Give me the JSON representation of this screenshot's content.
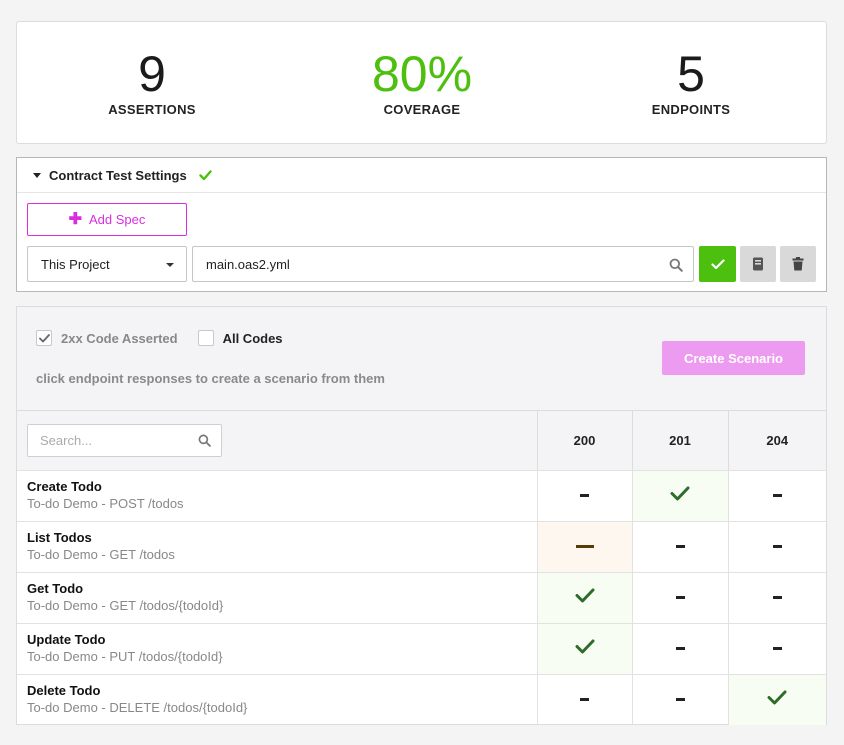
{
  "stats": [
    {
      "value": "9",
      "label": "ASSERTIONS"
    },
    {
      "value": "80%",
      "label": "COVERAGE"
    },
    {
      "value": "5",
      "label": "ENDPOINTS"
    }
  ],
  "colors": {
    "accent_green": "#4dbf0e",
    "accent_magenta": "#d92ee0",
    "create_button": "#ec9bf0"
  },
  "settings": {
    "title": "Contract Test Settings",
    "add_spec_label": "Add Spec",
    "source_select": "This Project",
    "spec_file": "main.oas2.yml"
  },
  "scenario": {
    "checkbox_2xx": "2xx Code Asserted",
    "checkbox_2xx_checked": true,
    "checkbox_all": "All Codes",
    "checkbox_all_checked": false,
    "hint": "click endpoint responses to create a scenario from them",
    "create_button": "Create Scenario",
    "search_placeholder": "Search...",
    "columns": [
      "200",
      "201",
      "204"
    ],
    "rows": [
      {
        "title": "Create Todo",
        "subtitle": "To-do Demo - POST /todos",
        "cells": [
          "dash",
          "check",
          "dash"
        ]
      },
      {
        "title": "List Todos",
        "subtitle": "To-do Demo - GET /todos",
        "cells": [
          "warn-dash",
          "dash",
          "dash"
        ]
      },
      {
        "title": "Get Todo",
        "subtitle": "To-do Demo - GET /todos/{todoId}",
        "cells": [
          "check",
          "dash",
          "dash"
        ]
      },
      {
        "title": "Update Todo",
        "subtitle": "To-do Demo - PUT /todos/{todoId}",
        "cells": [
          "check",
          "dash",
          "dash"
        ]
      },
      {
        "title": "Delete Todo",
        "subtitle": "To-do Demo - DELETE /todos/{todoId}",
        "cells": [
          "dash",
          "dash",
          "check"
        ]
      }
    ]
  }
}
